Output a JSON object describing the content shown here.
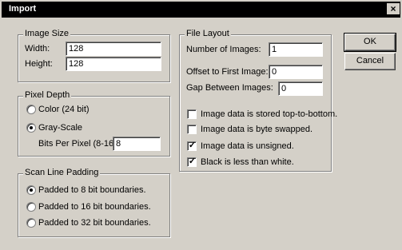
{
  "window": {
    "title": "Import",
    "close_glyph": "×"
  },
  "image_size": {
    "legend": "Image Size",
    "width_label": "Width:",
    "width_value": "128",
    "height_label": "Height:",
    "height_value": "128"
  },
  "pixel_depth": {
    "legend": "Pixel Depth",
    "color_label": "Color (24 bit)",
    "gray_label": "Gray-Scale",
    "bits_label": "Bits Per Pixel (8-16):",
    "bits_value": "8",
    "selected": "gray"
  },
  "scan_line_padding": {
    "legend": "Scan Line Padding",
    "options": [
      "Padded to 8 bit boundaries.",
      "Padded to 16 bit boundaries.",
      "Padded to 32 bit boundaries."
    ],
    "selected_index": 0
  },
  "file_layout": {
    "legend": "File Layout",
    "num_images_label": "Number of Images:",
    "num_images_value": "1",
    "offset_label": "Offset to First Image:",
    "offset_value": "0",
    "gap_label": "Gap Between Images:",
    "gap_value": "0",
    "checks": [
      {
        "label": "Image data is stored top-to-bottom.",
        "checked": false
      },
      {
        "label": "Image data is byte swapped.",
        "checked": false
      },
      {
        "label": "Image data is unsigned.",
        "checked": true
      },
      {
        "label": "Black is less than white.",
        "checked": true
      }
    ]
  },
  "buttons": {
    "ok": "OK",
    "cancel": "Cancel"
  },
  "check_glyph": "✓"
}
